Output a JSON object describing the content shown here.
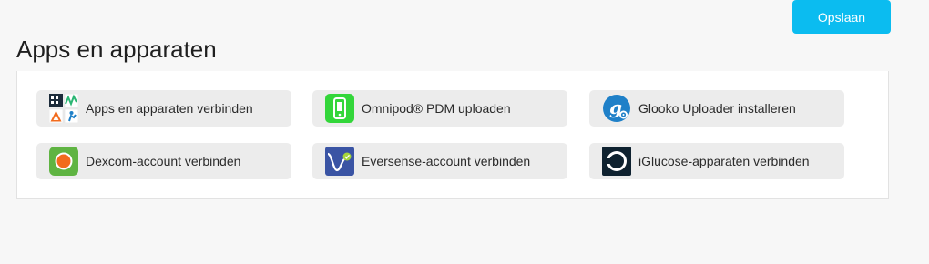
{
  "header": {
    "save_label": "Opslaan",
    "title": "Apps en apparaten"
  },
  "tiles": [
    {
      "label": "Apps en apparaten verbinden",
      "icon": "apps-grid-icon"
    },
    {
      "label": "Omnipod® PDM uploaden",
      "icon": "omnipod-pdm-icon"
    },
    {
      "label": "Glooko Uploader installeren",
      "icon": "glooko-uploader-icon"
    },
    {
      "label": "Dexcom-account verbinden",
      "icon": "dexcom-icon"
    },
    {
      "label": "Eversense-account verbinden",
      "icon": "eversense-icon"
    },
    {
      "label": "iGlucose-apparaten verbinden",
      "icon": "iglucose-icon"
    }
  ],
  "colors": {
    "accent": "#0bbcf0",
    "omnipod_green": "#33d63a",
    "glooko_blue": "#1f80c8",
    "dexcom_green": "#5fb442",
    "dexcom_orange": "#f26b1d",
    "eversense_blue": "#3a54a4",
    "iglucose_dark": "#0f2230"
  }
}
